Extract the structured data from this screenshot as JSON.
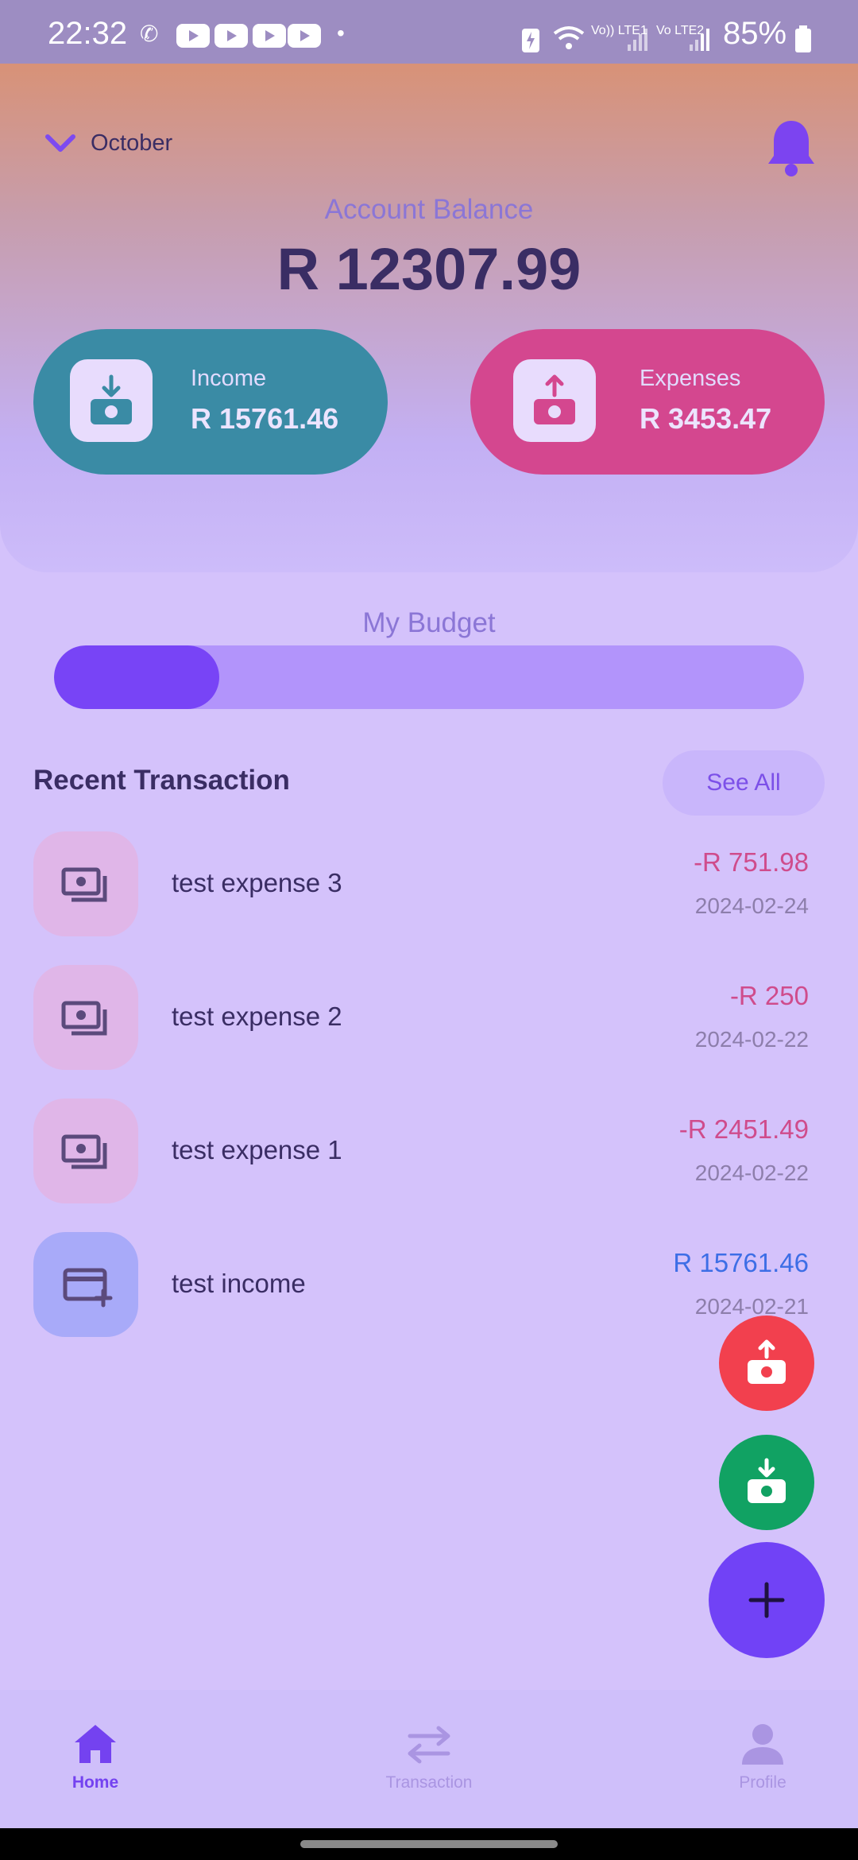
{
  "status_bar": {
    "time": "22:32",
    "battery": "85%",
    "network_1": "Vo)) LTE1",
    "network_2": "Vo LTE2"
  },
  "header": {
    "month": "October",
    "balance_label": "Account Balance",
    "balance_value": "R 12307.99"
  },
  "income_card": {
    "title": "Income",
    "amount": "R 15761.46",
    "icon": "money-in-icon"
  },
  "expense_card": {
    "title": "Expenses",
    "amount": "R 3453.47",
    "icon": "money-out-icon"
  },
  "budget": {
    "title": "My Budget",
    "progress_fraction": 0.22
  },
  "recent": {
    "title": "Recent Transaction",
    "see_all": "See All",
    "items": [
      {
        "name": "test expense 3",
        "amount": "-R 751.98",
        "date": "2024-02-24",
        "type": "expense",
        "icon": "cash-stack-icon"
      },
      {
        "name": "test expense 2",
        "amount": "-R 250",
        "date": "2024-02-22",
        "type": "expense",
        "icon": "cash-stack-icon"
      },
      {
        "name": "test expense 1",
        "amount": "-R 2451.49",
        "date": "2024-02-22",
        "type": "expense",
        "icon": "cash-stack-icon"
      },
      {
        "name": "test income",
        "amount": "R 15761.46",
        "date": "2024-02-21",
        "type": "income",
        "icon": "card-add-icon"
      }
    ]
  },
  "fabs": {
    "add_expense_icon": "money-out-icon",
    "add_income_icon": "money-in-icon",
    "add_label": "+"
  },
  "nav": {
    "home": "Home",
    "transaction": "Transaction",
    "profile": "Profile"
  },
  "colors": {
    "primary": "#7142f6",
    "income": "#3a8ba5",
    "expense": "#d4478f",
    "expense_text": "#cf4c8c",
    "income_text": "#3d6ee6"
  }
}
